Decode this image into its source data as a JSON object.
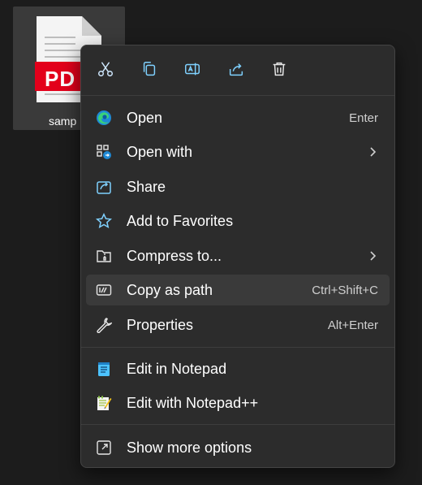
{
  "desktop": {
    "file_name": "samp",
    "file_badge": "PDF",
    "file_badge_visible": "PD"
  },
  "menu": {
    "quick_actions": [
      {
        "name": "cut",
        "icon": "scissors-icon"
      },
      {
        "name": "copy",
        "icon": "copy-icon"
      },
      {
        "name": "rename",
        "icon": "rename-icon"
      },
      {
        "name": "share",
        "icon": "share-icon"
      },
      {
        "name": "delete",
        "icon": "trash-icon"
      }
    ],
    "items": [
      {
        "label": "Open",
        "shortcut": "Enter",
        "icon": "edge-icon"
      },
      {
        "label": "Open with",
        "shortcut": "",
        "icon": "open-with-icon",
        "submenu": true
      },
      {
        "label": "Share",
        "shortcut": "",
        "icon": "share-icon"
      },
      {
        "label": "Add to Favorites",
        "shortcut": "",
        "icon": "star-icon"
      },
      {
        "label": "Compress to...",
        "shortcut": "",
        "icon": "zip-folder-icon",
        "submenu": true
      },
      {
        "label": "Copy as path",
        "shortcut": "Ctrl+Shift+C",
        "icon": "path-icon",
        "highlighted": true
      },
      {
        "label": "Properties",
        "shortcut": "Alt+Enter",
        "icon": "wrench-icon"
      },
      {
        "label": "Edit in Notepad",
        "shortcut": "",
        "icon": "notepad-icon"
      },
      {
        "label": "Edit with Notepad++",
        "shortcut": "",
        "icon": "notepad-plus-icon"
      },
      {
        "label": "Show more options",
        "shortcut": "",
        "icon": "more-options-icon"
      }
    ]
  },
  "colors": {
    "menu_bg": "#2c2c2c",
    "accent_blue": "#4cc2ff",
    "pdf_red": "#e3001b"
  }
}
